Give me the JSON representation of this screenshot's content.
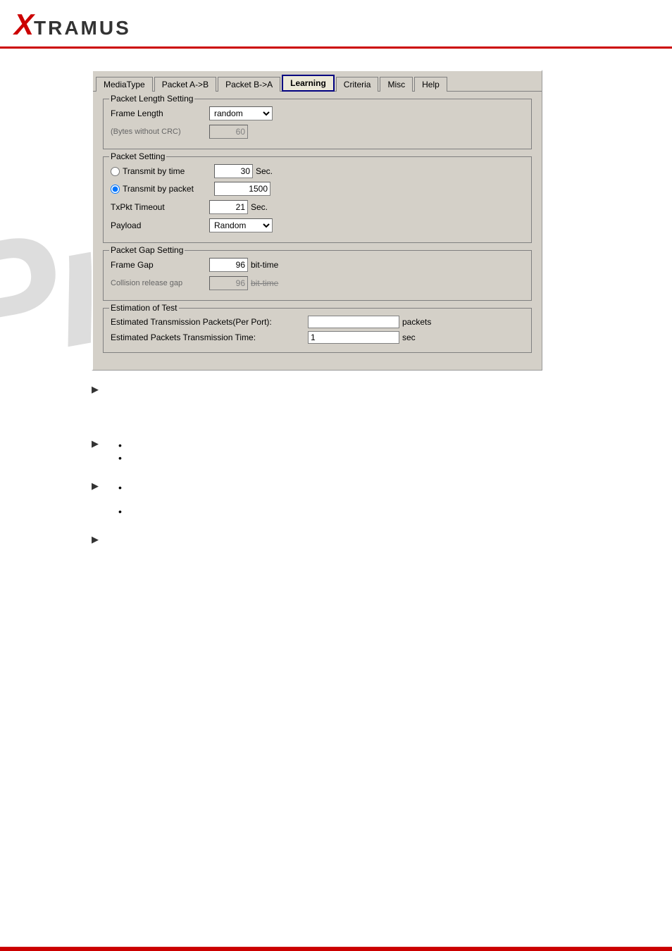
{
  "header": {
    "logo_x": "X",
    "logo_text": "TRAMUS"
  },
  "tabs": [
    {
      "label": "MediaType",
      "active": false
    },
    {
      "label": "Packet A->B",
      "active": false
    },
    {
      "label": "Packet B->A",
      "active": false
    },
    {
      "label": "Learning",
      "active": true
    },
    {
      "label": "Criteria",
      "active": false
    },
    {
      "label": "Misc",
      "active": false
    },
    {
      "label": "Help",
      "active": false
    }
  ],
  "packet_length_setting": {
    "legend": "Packet Length Setting",
    "frame_length_label": "Frame Length",
    "frame_length_value": "random",
    "bytes_crc_label": "(Bytes without CRC)",
    "bytes_crc_value": "60"
  },
  "packet_setting": {
    "legend": "Packet Setting",
    "transmit_by_time_label": "Transmit by time",
    "transmit_by_time_value": "30",
    "transmit_by_time_unit": "Sec.",
    "transmit_by_packet_label": "Transmit by packet",
    "transmit_by_packet_value": "1500",
    "txpkt_timeout_label": "TxPkt Timeout",
    "txpkt_timeout_value": "21",
    "txpkt_timeout_unit": "Sec.",
    "payload_label": "Payload",
    "payload_value": "Random"
  },
  "packet_gap_setting": {
    "legend": "Packet Gap Setting",
    "frame_gap_label": "Frame Gap",
    "frame_gap_value": "96",
    "frame_gap_unit": "bit-time",
    "collision_release_label": "Collision release gap",
    "collision_release_value": "96",
    "collision_release_unit": "bit-time"
  },
  "estimation": {
    "legend": "Estimation of Test",
    "packets_label": "Estimated Transmission Packets(Per Port):",
    "packets_value": "",
    "packets_unit": "packets",
    "time_label": "Estimated Packets Transmission Time:",
    "time_value": "1",
    "time_unit": "sec"
  },
  "watermark": "Prelim",
  "text_blocks": [
    {
      "type": "arrow",
      "content": ""
    },
    {
      "type": "arrow",
      "content": "",
      "bullets": [
        "",
        ""
      ]
    },
    {
      "type": "arrow",
      "content": "",
      "bullets": [
        "",
        ""
      ]
    },
    {
      "type": "arrow",
      "content": ""
    }
  ]
}
